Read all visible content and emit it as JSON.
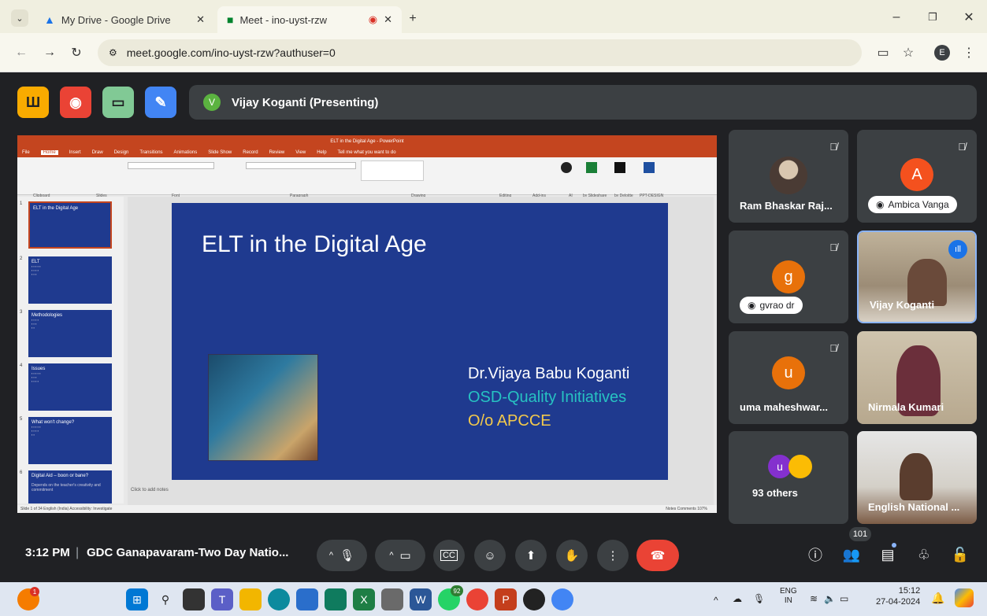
{
  "browser": {
    "tabs": [
      {
        "title": "My Drive - Google Drive",
        "icon": "google-drive-icon"
      },
      {
        "title": "Meet - ino-uyst-rzw",
        "icon": "google-meet-icon"
      }
    ],
    "url": "meet.google.com/ino-uyst-rzw?authuser=0",
    "profile_initial": "E"
  },
  "meet": {
    "presenter_initial": "V",
    "presenting_label": "Vijay Koganti (Presenting)",
    "time": "3:12 PM",
    "meeting_title": "GDC Ganapavaram-Two Day Natio...",
    "people_count": "101",
    "end_call_color": "#ea4335"
  },
  "ppt": {
    "window_title": "ELT in the Digital Age - PowerPoint",
    "menu": [
      "File",
      "Home",
      "Insert",
      "Draw",
      "Design",
      "Transitions",
      "Animations",
      "Slide Show",
      "Record",
      "Review",
      "View",
      "Help",
      "Tell me what you want to do"
    ],
    "ribbon_groups": [
      "Clipboard",
      "Slides",
      "Font",
      "Paragraph",
      "Drawing",
      "Editing",
      "Add-ins",
      "AI",
      "by Slideshare",
      "by Deloitte",
      "PPT-DESIGN"
    ],
    "slide": {
      "title": "ELT in the Digital Age",
      "line1": "Dr.Vijaya Babu Koganti",
      "line2": "OSD-Quality Initiatives",
      "line3": "O/o APCCE"
    },
    "thumbnails": [
      {
        "num": "1",
        "title": "ELT in the Digital Age"
      },
      {
        "num": "2",
        "title": "ELT"
      },
      {
        "num": "3",
        "title": "Methodologies"
      },
      {
        "num": "4",
        "title": "Issues"
      },
      {
        "num": "5",
        "title": "What won't change?"
      },
      {
        "num": "6",
        "title": "Digital Aid – boon or bane?",
        "sub": "Depends on the teacher's creativity and commitment"
      }
    ],
    "notes_placeholder": "Click to add notes",
    "status": "Slide 1 of 34    English (India)    Accessibility: Investigate",
    "status_right": "Notes   Comments   107%"
  },
  "participants": [
    {
      "name": "Ram Bhaskar Raj...",
      "kind": "photo",
      "muted": true
    },
    {
      "name": "Ambica Vanga",
      "kind": "avatar",
      "initial": "A",
      "color": "#f4511e",
      "muted": true,
      "pill": true
    },
    {
      "name": "gvrao dr",
      "kind": "avatar",
      "initial": "g",
      "color": "#e8710a",
      "muted": true,
      "pill": true
    },
    {
      "name": "Vijay Koganti",
      "kind": "photo",
      "speaking": true
    },
    {
      "name": "uma maheshwar...",
      "kind": "avatar",
      "initial": "u",
      "color": "#e8710a",
      "muted": true
    },
    {
      "name": "Nirmala Kumari",
      "kind": "photo"
    },
    {
      "name": "93 others",
      "kind": "others",
      "initial": "u",
      "color": "#8430ce"
    },
    {
      "name": "English National ...",
      "kind": "photo"
    }
  ],
  "taskbar": {
    "lang": "ENG",
    "region": "IN",
    "time": "15:12",
    "date": "27-04-2024",
    "whatsapp_badge": "92"
  }
}
